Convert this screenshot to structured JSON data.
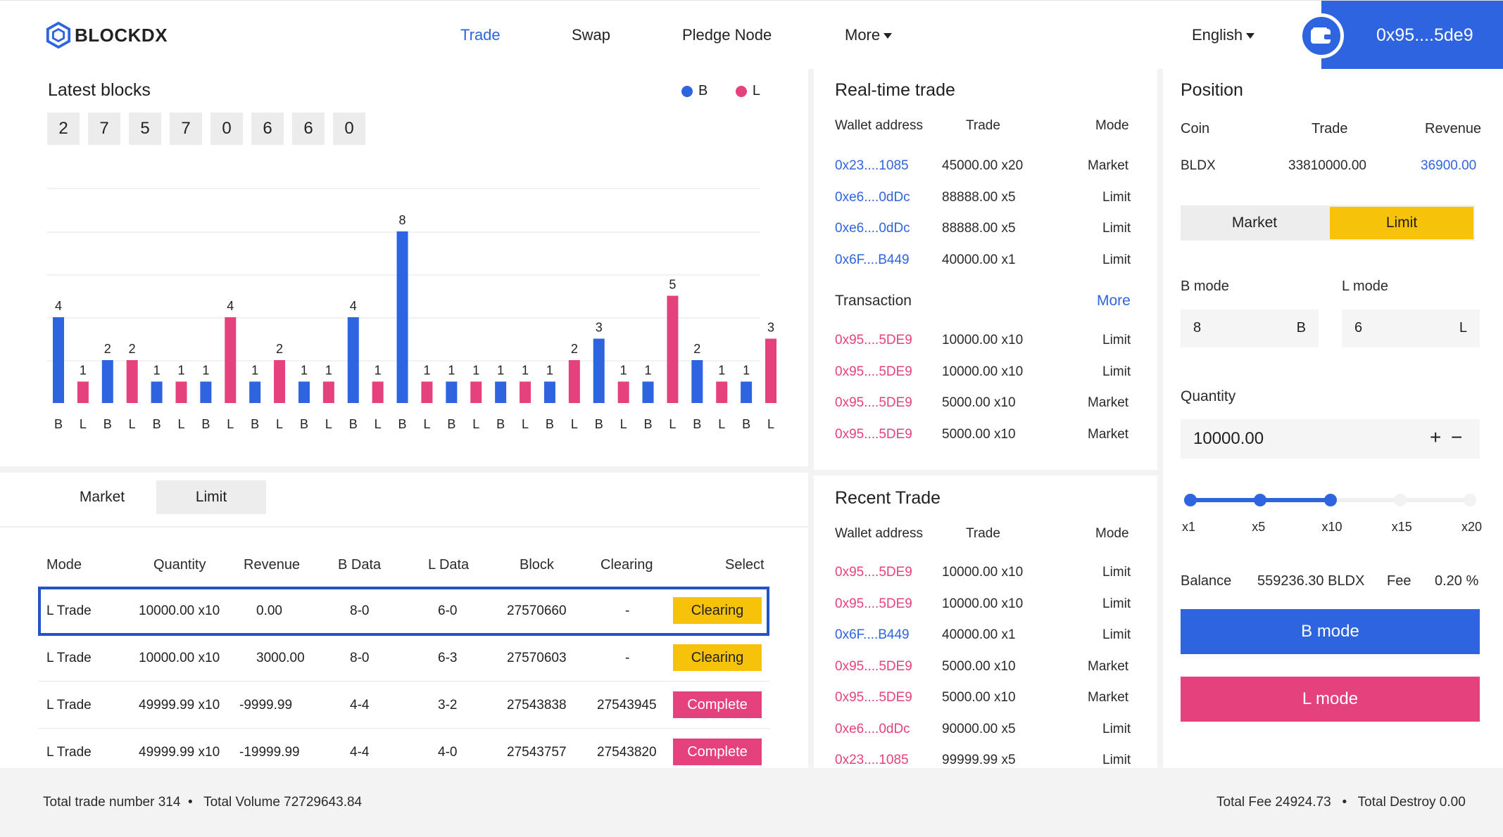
{
  "header": {
    "logo": "BLOCKDX",
    "nav": [
      "Trade",
      "Swap",
      "Pledge Node",
      "More"
    ],
    "language": "English",
    "wallet": "0x95....5de9"
  },
  "blocks": {
    "title": "Latest blocks",
    "legend": [
      "B",
      "L"
    ],
    "digits": [
      "2",
      "7",
      "5",
      "7",
      "0",
      "6",
      "6",
      "0"
    ]
  },
  "chart_data": {
    "type": "bar",
    "categories": [
      "B",
      "L",
      "B",
      "L",
      "B",
      "L",
      "B",
      "L",
      "B",
      "L",
      "B",
      "L",
      "B",
      "L",
      "B",
      "L",
      "B",
      "L",
      "B",
      "L",
      "B",
      "L",
      "B",
      "L",
      "B",
      "L",
      "B",
      "L",
      "B",
      "L"
    ],
    "values": [
      4,
      1,
      2,
      2,
      1,
      1,
      1,
      4,
      1,
      2,
      1,
      1,
      4,
      1,
      8,
      1,
      1,
      1,
      1,
      1,
      1,
      2,
      3,
      1,
      1,
      5,
      2,
      1,
      1,
      3
    ],
    "colors": {
      "B": "#2f64e0",
      "L": "#e5427d"
    },
    "ylim": [
      0,
      10
    ],
    "grid": true,
    "legend": "top-right"
  },
  "order_tabs": [
    "Market",
    "Limit"
  ],
  "orders": {
    "headers": [
      "Mode",
      "Quantity",
      "Revenue",
      "B Data",
      "L Data",
      "Block",
      "Clearing",
      "Select"
    ],
    "rows": [
      {
        "mode": "L Trade",
        "qty": "10000.00 x10",
        "rev": "0.00",
        "b": "8-0",
        "l": "6-0",
        "block": "27570660",
        "clearing": "-",
        "select": "Clearing"
      },
      {
        "mode": "L Trade",
        "qty": "10000.00 x10",
        "rev": "3000.00",
        "b": "8-0",
        "l": "6-3",
        "block": "27570603",
        "clearing": "-",
        "select": "Clearing"
      },
      {
        "mode": "L Trade",
        "qty": "49999.99 x10",
        "rev": "-9999.99",
        "b": "4-4",
        "l": "3-2",
        "block": "27543838",
        "clearing": "27543945",
        "select": "Complete"
      },
      {
        "mode": "L Trade",
        "qty": "49999.99 x10",
        "rev": "-19999.99",
        "b": "4-4",
        "l": "4-0",
        "block": "27543757",
        "clearing": "27543820",
        "select": "Complete"
      }
    ]
  },
  "realtime": {
    "title": "Real-time trade",
    "headers": [
      "Wallet address",
      "Trade",
      "Mode"
    ],
    "rows": [
      {
        "addr": "0x23....1085",
        "trade": "45000.00 x20",
        "mode": "Market"
      },
      {
        "addr": "0xe6....0dDc",
        "trade": "88888.00 x5",
        "mode": "Limit"
      },
      {
        "addr": "0xe6....0dDc",
        "trade": "88888.00 x5",
        "mode": "Limit"
      },
      {
        "addr": "0x6F....B449",
        "trade": "40000.00 x1",
        "mode": "Limit"
      }
    ],
    "tx_title": "Transaction",
    "tx_more": "More",
    "tx_rows": [
      {
        "addr": "0x95....5DE9",
        "trade": "10000.00 x10",
        "mode": "Limit"
      },
      {
        "addr": "0x95....5DE9",
        "trade": "10000.00 x10",
        "mode": "Limit"
      },
      {
        "addr": "0x95....5DE9",
        "trade": "5000.00 x10",
        "mode": "Market"
      },
      {
        "addr": "0x95....5DE9",
        "trade": "5000.00 x10",
        "mode": "Market"
      }
    ]
  },
  "recent": {
    "title": "Recent Trade",
    "headers": [
      "Wallet address",
      "Trade",
      "Mode"
    ],
    "rows": [
      {
        "addr": "0x95....5DE9",
        "trade": "10000.00 x10",
        "mode": "Limit",
        "color": "pink"
      },
      {
        "addr": "0x95....5DE9",
        "trade": "10000.00 x10",
        "mode": "Limit",
        "color": "pink"
      },
      {
        "addr": "0x6F....B449",
        "trade": "40000.00 x1",
        "mode": "Limit",
        "color": "blue"
      },
      {
        "addr": "0x95....5DE9",
        "trade": "5000.00 x10",
        "mode": "Market",
        "color": "pink"
      },
      {
        "addr": "0x95....5DE9",
        "trade": "5000.00 x10",
        "mode": "Market",
        "color": "pink"
      },
      {
        "addr": "0xe6....0dDc",
        "trade": "90000.00 x5",
        "mode": "Limit",
        "color": "pink"
      },
      {
        "addr": "0x23....1085",
        "trade": "99999.99 x5",
        "mode": "Limit",
        "color": "pink"
      }
    ]
  },
  "position": {
    "title": "Position",
    "headers": [
      "Coin",
      "Trade",
      "Revenue"
    ],
    "coin": "BLDX",
    "trade": "33810000.00",
    "revenue": "36900.00",
    "tabs": [
      "Market",
      "Limit"
    ],
    "b_mode_label": "B mode",
    "l_mode_label": "L mode",
    "b_value": "8",
    "b_suffix": "B",
    "l_value": "6",
    "l_suffix": "L",
    "quantity_label": "Quantity",
    "quantity": "10000.00",
    "plus": "+",
    "minus": "−",
    "leverage_marks": [
      "x1",
      "x5",
      "x10",
      "x15",
      "x20"
    ],
    "leverage_selected_fraction": 0.5,
    "balance_label": "Balance",
    "balance": "559236.30 BLDX",
    "fee_label": "Fee",
    "fee": "0.20 %",
    "b_button": "B mode",
    "l_button": "L mode"
  },
  "footer": {
    "left": "Total trade number 314  •   Total Volume 72729643.84",
    "right": "Total Fee 24924.73   •   Total Destroy 0.00"
  }
}
